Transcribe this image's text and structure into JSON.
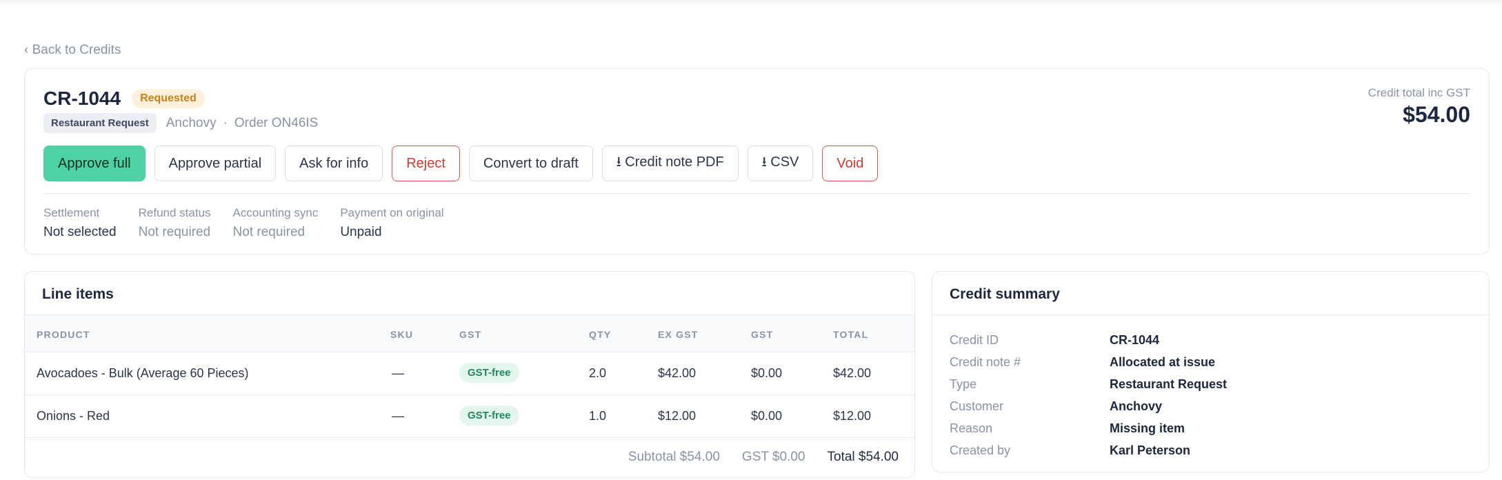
{
  "nav": {
    "back_label": "‹ Back to Credits"
  },
  "credit": {
    "id": "CR-1044",
    "status": "Requested",
    "type_tag": "Restaurant Request",
    "customer": "Anchovy",
    "separator": "·",
    "order": "Order ON46IS",
    "total_label": "Credit total inc GST",
    "total_value": "$54.00"
  },
  "actions": [
    {
      "label": "Approve full"
    },
    {
      "label": "Approve partial"
    },
    {
      "label": "Ask for info"
    },
    {
      "label": "Reject"
    },
    {
      "label": "Convert to draft"
    },
    {
      "label": "⭳ Credit note PDF"
    },
    {
      "label": "⭳ CSV"
    },
    {
      "label": "Void"
    }
  ],
  "status_fields": [
    {
      "label": "Settlement",
      "value": "Not selected"
    },
    {
      "label": "Refund status",
      "value": "Not required"
    },
    {
      "label": "Accounting sync",
      "value": "Not required"
    },
    {
      "label": "Payment on original",
      "value": "Unpaid"
    }
  ],
  "line_items": {
    "title": "Line items",
    "columns": [
      "PRODUCT",
      "SKU",
      "GST",
      "QTY",
      "EX GST",
      "GST",
      "TOTAL"
    ],
    "rows": [
      {
        "product": "Avocadoes - Bulk (Average 60 Pieces)",
        "sku": "—",
        "gst_type": "GST-free",
        "qty": "2.0",
        "ex_gst": "$42.00",
        "gst": "$0.00",
        "total": "$42.00"
      },
      {
        "product": "Onions - Red",
        "sku": "—",
        "gst_type": "GST-free",
        "qty": "1.0",
        "ex_gst": "$12.00",
        "gst": "$0.00",
        "total": "$12.00"
      }
    ],
    "subtotal": "Subtotal $54.00",
    "gst_total": "GST $0.00",
    "grand_total": "Total $54.00"
  },
  "summary": {
    "title": "Credit summary",
    "rows": [
      {
        "key": "Credit ID",
        "value": "CR-1044"
      },
      {
        "key": "Credit note #",
        "value": "Allocated at issue"
      },
      {
        "key": "Type",
        "value": "Restaurant Request"
      },
      {
        "key": "Customer",
        "value": "Anchovy"
      },
      {
        "key": "Reason",
        "value": "Missing item"
      },
      {
        "key": "Created by",
        "value": "Karl Peterson"
      }
    ]
  },
  "colors": {
    "accent": "#4fd1a6",
    "danger": "#cc3a30",
    "warning_badge": "#c9811c",
    "gst_free": "#1d8a5b"
  }
}
